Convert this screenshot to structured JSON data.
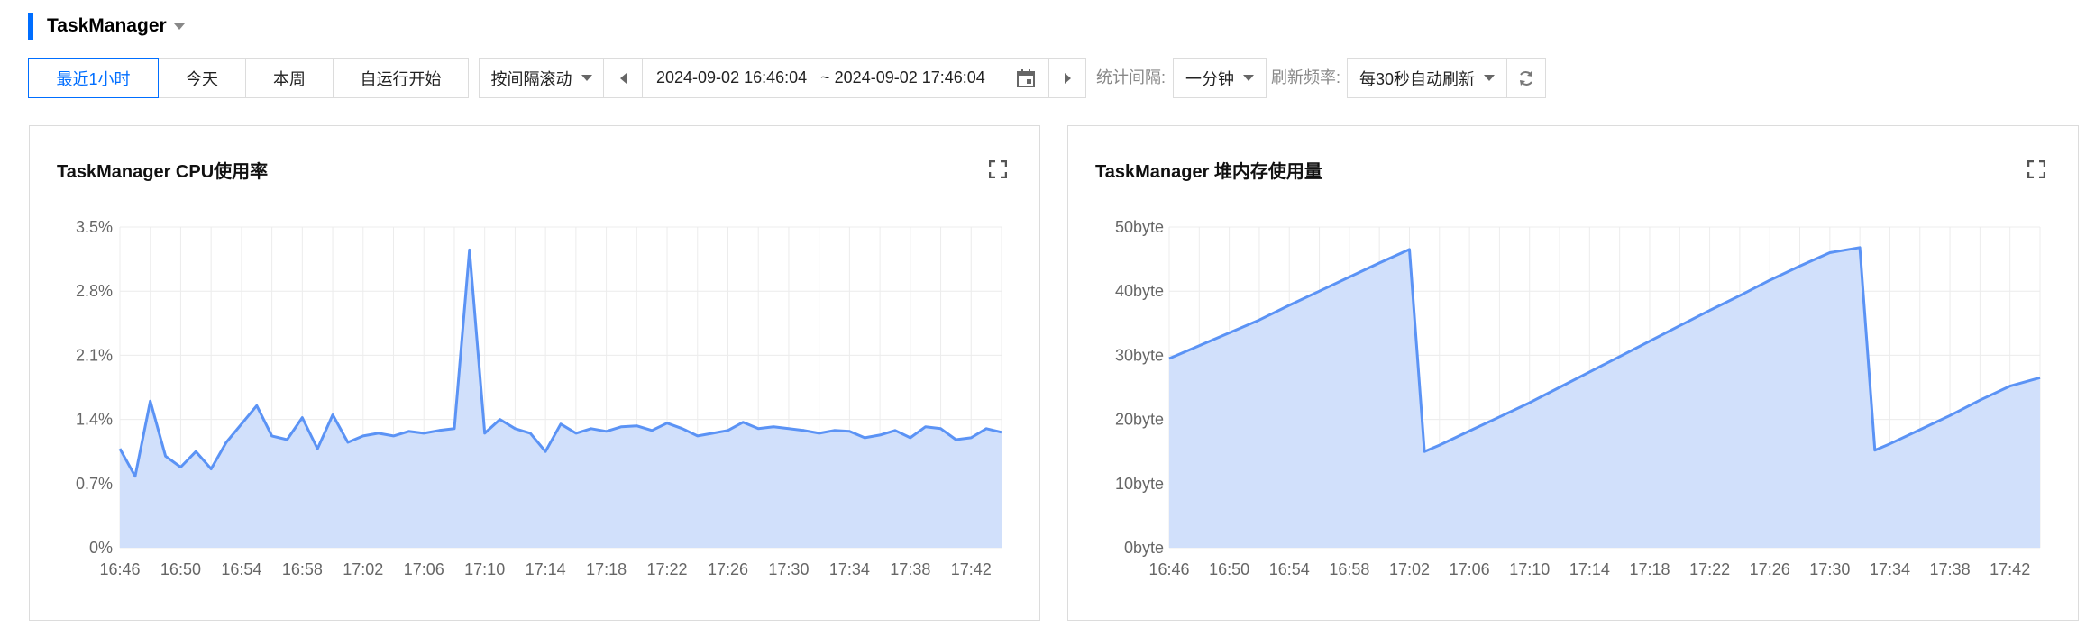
{
  "header": {
    "title": "TaskManager"
  },
  "time_tabs": [
    {
      "label": "最近1小时",
      "active": true
    },
    {
      "label": "今天",
      "active": false
    },
    {
      "label": "本周",
      "active": false
    },
    {
      "label": "自运行开始",
      "active": false
    }
  ],
  "range_mode": "按间隔滚动",
  "date_range": "2024-09-02 16:46:04   ~ 2024-09-02 17:46:04",
  "interval": {
    "label": "统计间隔:",
    "value": "一分钟"
  },
  "refresh": {
    "label": "刷新频率:",
    "value": "每30秒自动刷新"
  },
  "colors": {
    "accent": "#006eff",
    "line": "#5b93f5",
    "fill": "#d1e0fb"
  },
  "icons": [
    "calendar-icon",
    "refresh-icon",
    "expand-icon",
    "prev-icon",
    "next-icon",
    "caret-down-icon"
  ],
  "chart_data": [
    {
      "type": "area",
      "title": "TaskManager CPU使用率",
      "x_ticks": [
        "16:46",
        "16:50",
        "16:54",
        "16:58",
        "17:02",
        "17:06",
        "17:10",
        "17:14",
        "17:18",
        "17:22",
        "17:26",
        "17:30",
        "17:34",
        "17:38",
        "17:42"
      ],
      "y_ticks": [
        "0%",
        "0.7%",
        "1.4%",
        "2.1%",
        "2.8%",
        "3.5%"
      ],
      "ylim": [
        0,
        3.5
      ],
      "xlim": [
        "16:46",
        "17:44"
      ],
      "unit": "%",
      "grid": true,
      "series": [
        {
          "x": [
            "16:46",
            "16:47",
            "16:48",
            "16:49",
            "16:50",
            "16:51",
            "16:52",
            "16:53",
            "16:54",
            "16:55",
            "16:56",
            "16:57",
            "16:58",
            "16:59",
            "17:00",
            "17:01",
            "17:02",
            "17:03",
            "17:04",
            "17:05",
            "17:06",
            "17:07",
            "17:08",
            "17:09",
            "17:10",
            "17:11",
            "17:12",
            "17:13",
            "17:14",
            "17:15",
            "17:16",
            "17:17",
            "17:18",
            "17:19",
            "17:20",
            "17:21",
            "17:22",
            "17:23",
            "17:24",
            "17:25",
            "17:26",
            "17:27",
            "17:28",
            "17:29",
            "17:30",
            "17:31",
            "17:32",
            "17:33",
            "17:34",
            "17:35",
            "17:36",
            "17:37",
            "17:38",
            "17:39",
            "17:40",
            "17:41",
            "17:42",
            "17:43",
            "17:44"
          ],
          "values": [
            1.08,
            0.78,
            1.6,
            1.0,
            0.88,
            1.05,
            0.86,
            1.15,
            1.35,
            1.55,
            1.22,
            1.18,
            1.42,
            1.08,
            1.45,
            1.15,
            1.22,
            1.25,
            1.22,
            1.27,
            1.25,
            1.28,
            1.3,
            3.25,
            1.25,
            1.4,
            1.3,
            1.25,
            1.05,
            1.35,
            1.25,
            1.3,
            1.27,
            1.32,
            1.33,
            1.28,
            1.36,
            1.3,
            1.22,
            1.25,
            1.28,
            1.37,
            1.3,
            1.32,
            1.3,
            1.28,
            1.25,
            1.28,
            1.27,
            1.2,
            1.23,
            1.28,
            1.2,
            1.32,
            1.3,
            1.18,
            1.2,
            1.3,
            1.26
          ]
        }
      ]
    },
    {
      "type": "area",
      "title": "TaskManager 堆内存使用量",
      "x_ticks": [
        "16:46",
        "16:50",
        "16:54",
        "16:58",
        "17:02",
        "17:06",
        "17:10",
        "17:14",
        "17:18",
        "17:22",
        "17:26",
        "17:30",
        "17:34",
        "17:38",
        "17:42"
      ],
      "y_ticks": [
        "0byte",
        "10byte",
        "20byte",
        "30byte",
        "40byte",
        "50byte"
      ],
      "ylim": [
        0,
        50
      ],
      "xlim": [
        "16:46",
        "17:44"
      ],
      "unit": "byte",
      "grid": true,
      "series": [
        {
          "x": [
            "16:46",
            "16:48",
            "16:50",
            "16:52",
            "16:54",
            "16:56",
            "16:58",
            "17:00",
            "17:02",
            "17:03",
            "17:04",
            "17:06",
            "17:08",
            "17:10",
            "17:12",
            "17:14",
            "17:16",
            "17:18",
            "17:20",
            "17:22",
            "17:24",
            "17:26",
            "17:28",
            "17:30",
            "17:32",
            "17:33",
            "17:34",
            "17:36",
            "17:38",
            "17:40",
            "17:42",
            "17:44"
          ],
          "values": [
            29.5,
            31.5,
            33.5,
            35.5,
            37.8,
            40.0,
            42.2,
            44.4,
            46.5,
            15.0,
            16.0,
            18.2,
            20.4,
            22.6,
            25.0,
            27.4,
            29.8,
            32.2,
            34.6,
            37.0,
            39.3,
            41.7,
            43.9,
            46.0,
            46.8,
            15.2,
            16.2,
            18.4,
            20.6,
            23.0,
            25.2,
            26.5
          ]
        }
      ]
    }
  ]
}
